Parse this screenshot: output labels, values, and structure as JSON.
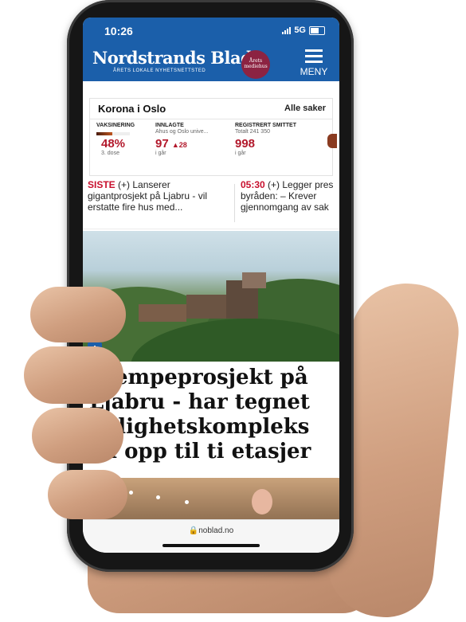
{
  "status_bar": {
    "time": "10:26",
    "network": "5G"
  },
  "header": {
    "logo": "Nordstrands Blad",
    "tagline": "ÅRETS LOKALE NYHETSNETTSTED",
    "badge_text": "Årets mediehus",
    "menu_label": "MENY",
    "brand_color": "#1b5faa"
  },
  "korona": {
    "title": "Korona i Oslo",
    "all_link": "Alle saker",
    "vaccination": {
      "label": "VAKSINERING",
      "value": "48%",
      "sub": "3. dose",
      "progress": 0.48
    },
    "hospitalized": {
      "label": "INNLAGTE",
      "sub": "Ahus og Oslo unive...",
      "value": "97",
      "change": "28",
      "period": "i går"
    },
    "infected": {
      "label": "REGISTRERT SMITTET",
      "sub": "Totalt 241 350",
      "value": "998",
      "period": "i går"
    }
  },
  "ticker": [
    {
      "tag": "SISTE",
      "text": "(+) Lanserer gigantprosjekt på Ljabru - vil erstatte fire hus med..."
    },
    {
      "tag": "05:30",
      "text": "(+) Legger pres byråden: – Krever gjennomgang av sak"
    }
  ],
  "article": {
    "plus_badge": "+",
    "headline": "Kjempeprosjekt på Ljabru - har tegnet leilighetskompleks på opp til ti etasjer"
  },
  "browser": {
    "url": "noblad.no"
  }
}
